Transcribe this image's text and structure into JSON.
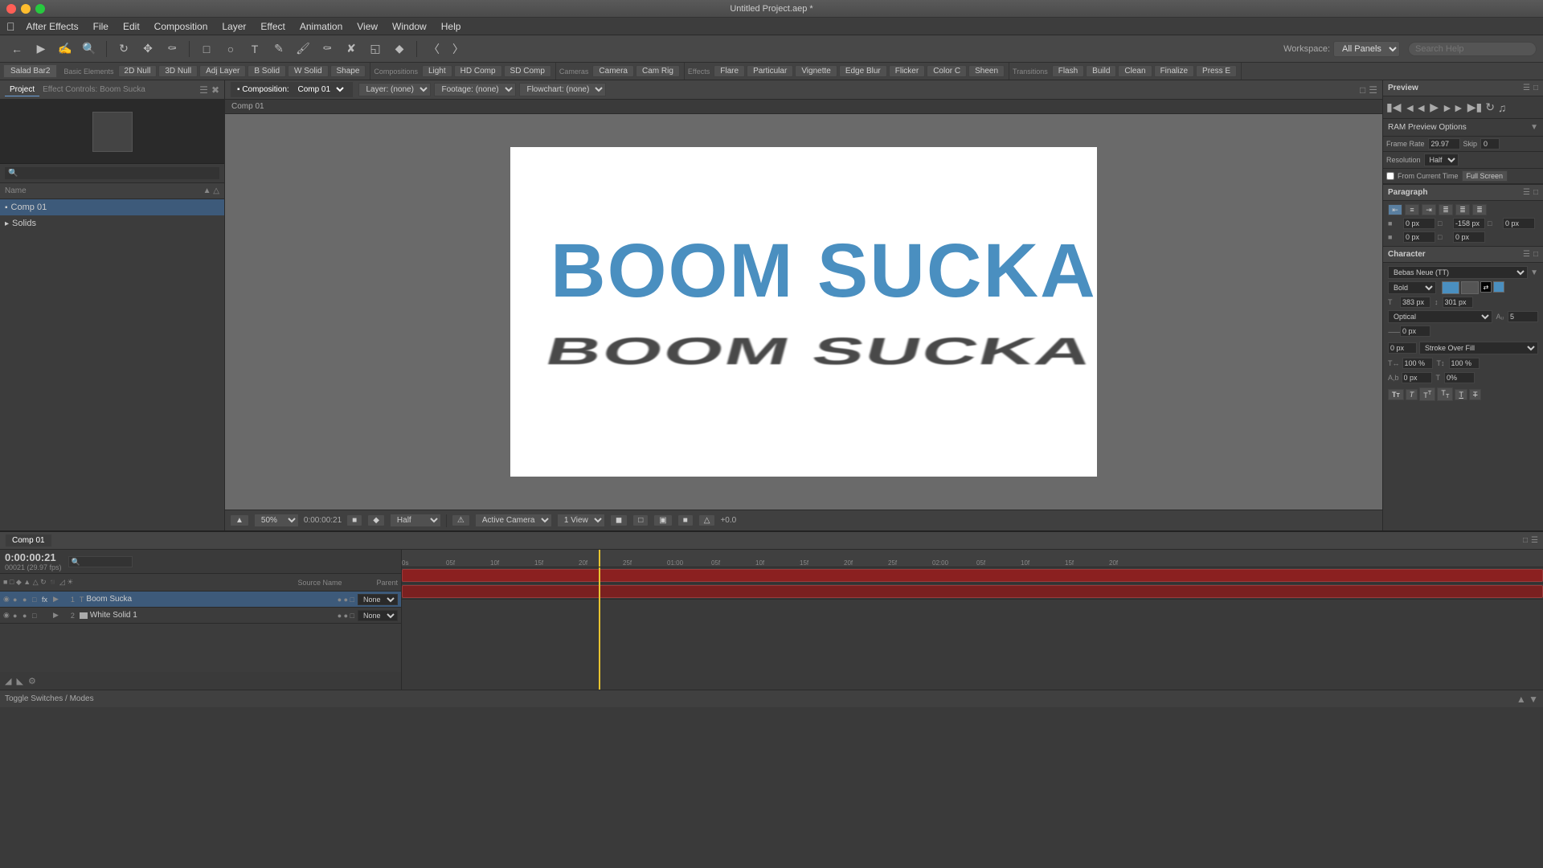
{
  "titleBar": {
    "title": "Untitled Project.aep *"
  },
  "menuBar": {
    "apple": "&#63743;",
    "appName": "After Effects",
    "items": [
      "File",
      "Edit",
      "Composition",
      "Layer",
      "Effect",
      "Animation",
      "View",
      "Window",
      "Help"
    ]
  },
  "toolbar": {
    "workspace_label": "Workspace:",
    "workspace_value": "All Panels",
    "search_placeholder": "Search Help"
  },
  "effectsBar": {
    "saladTab": "Salad Bar2",
    "sections": [
      {
        "label": "Basic Elements",
        "buttons": [
          "2D Null",
          "3D Null",
          "Adj Layer",
          "B Solid",
          "W Solid",
          "Shape"
        ]
      },
      {
        "label": "Compositions",
        "buttons": [
          "Light",
          "HD Comp",
          "SD Comp"
        ]
      },
      {
        "label": "Cameras",
        "buttons": [
          "Camera",
          "Cam Rig"
        ]
      },
      {
        "label": "Effects",
        "buttons": [
          "Flare",
          "Particular",
          "Vignette",
          "Edge Blur",
          "Flicker",
          "Color C",
          "Sheen"
        ]
      },
      {
        "label": "Transitions",
        "buttons": [
          "Flash",
          "Build",
          "Clean",
          "Finalize",
          "Press E"
        ]
      }
    ]
  },
  "projectPanel": {
    "tab": "Project",
    "effectControls": "Effect Controls: Boom Sucka",
    "items": [
      {
        "name": "Comp 01",
        "type": "comp",
        "indent": false
      },
      {
        "name": "Solids",
        "type": "folder",
        "indent": false
      }
    ]
  },
  "compViewer": {
    "tab": "Composition: Comp 01",
    "layer": "Layer: (none)",
    "footage": "Footage: (none)",
    "flowchart": "Flowchart: (none)",
    "compLabel": "Comp 01",
    "text": "BOOM SUCKA",
    "zoom": "50%",
    "time": "0:00:00:21",
    "resolution": "Half",
    "views": "1 View",
    "camera": "Active Camera",
    "info": "+0.0"
  },
  "previewPanel": {
    "title": "Preview",
    "ramPreview": "RAM Preview Options",
    "frameRateLabel": "Frame Rate",
    "skipLabel": "Skip",
    "resolutionLabel": "Resolution",
    "frameRateValue": "29.97",
    "skipValue": "0",
    "resolutionValue": "Half",
    "fromCurrentTime": "From Current Time",
    "fullScreen": "Full Screen"
  },
  "paragraphPanel": {
    "title": "Paragraph",
    "indent1": "0 px",
    "indent2": "-158 px",
    "indent3": "0 px",
    "indent4": "0 px",
    "indent5": "0 px"
  },
  "characterPanel": {
    "title": "Character",
    "font": "Bebas Neue (TT)",
    "style": "Bold",
    "size": "383 px",
    "vertSize": "301 px",
    "optical": "Optical",
    "autoVal": "5",
    "tracking": "0 px",
    "strokeFill": "Stroke Over Fill",
    "strokeVal": "0 px",
    "horizScale": "100 %",
    "vertScale": "100 %",
    "baseline": "0 px",
    "tsume": "0%"
  },
  "timeline": {
    "tab": "Comp 01",
    "time": "0:00:00:21",
    "fps": "00021 (29.97 fps)",
    "layers": [
      {
        "num": "1",
        "name": "Boom Sucka",
        "type": "text",
        "parent": "None"
      },
      {
        "num": "2",
        "name": "White Solid 1",
        "type": "solid",
        "parent": "None"
      }
    ],
    "playheadPos": "245",
    "footer": "Toggle Switches / Modes"
  }
}
